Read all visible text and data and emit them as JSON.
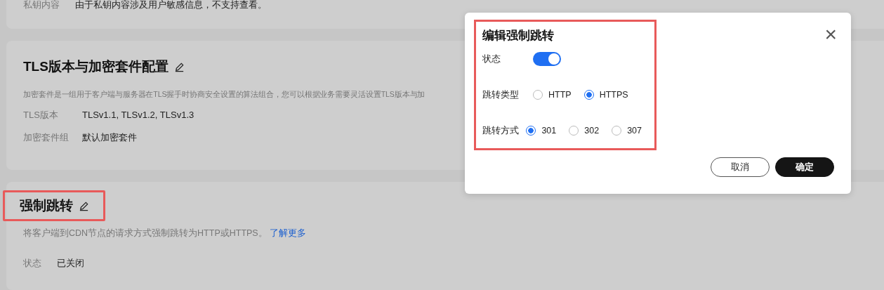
{
  "private_key": {
    "label": "私钥内容",
    "value": "由于私钥内容涉及用户敏感信息，不支持查看。"
  },
  "tls_section": {
    "title": "TLS版本与加密套件配置",
    "description": "加密套件是一组用于客户端与服务器在TLS握手时协商安全设置的算法组合，您可以根据业务需要灵活设置TLS版本与加",
    "fields": [
      {
        "label": "TLS版本",
        "value": "TLSv1.1, TLSv1.2, TLSv1.3"
      },
      {
        "label": "加密套件组",
        "value": "默认加密套件"
      }
    ]
  },
  "redirect_section": {
    "title": "强制跳转",
    "description": "将客户端到CDN节点的请求方式强制跳转为HTTP或HTTPS。",
    "link": "了解更多",
    "fields": [
      {
        "label": "状态",
        "value": "已关闭"
      }
    ]
  },
  "dialog": {
    "title": "编辑强制跳转",
    "close": "×",
    "rows": [
      {
        "kind": "switch",
        "label": "状态",
        "on": true
      },
      {
        "kind": "radio",
        "label": "跳转类型",
        "options": [
          {
            "label": "HTTP",
            "selected": false
          },
          {
            "label": "HTTPS",
            "selected": true
          }
        ]
      },
      {
        "kind": "radio",
        "label": "跳转方式",
        "options": [
          {
            "label": "301",
            "selected": true
          },
          {
            "label": "302",
            "selected": false
          },
          {
            "label": "307",
            "selected": false
          }
        ]
      }
    ],
    "buttons": [
      {
        "kind": "secondary",
        "label": "取消"
      },
      {
        "kind": "primary",
        "label": "确定"
      }
    ]
  }
}
